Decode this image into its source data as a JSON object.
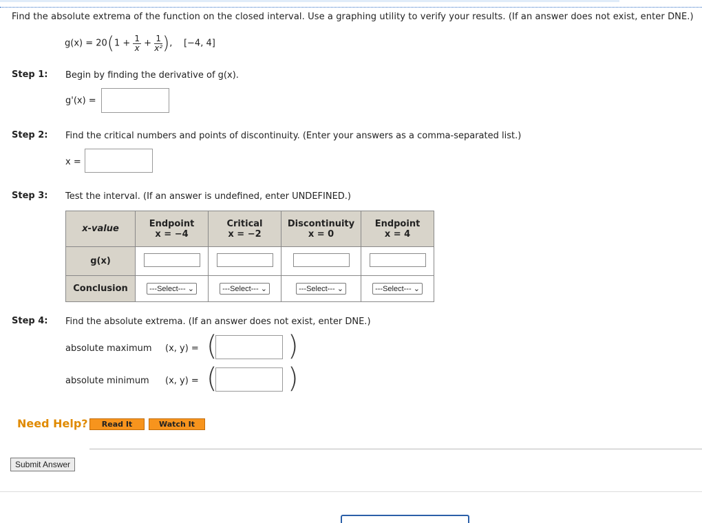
{
  "question": "Find the absolute extrema of the function on the closed interval. Use a graphing utility to verify your results. (If an answer does not exist, enter DNE.)",
  "function": {
    "lhs": "g(x) = 20",
    "one_plus": "1 +",
    "frac1_num": "1",
    "frac1_den": "x",
    "plus": "+",
    "frac2_num": "1",
    "frac2_den": "x²",
    "interval": "[−4, 4]"
  },
  "steps": [
    {
      "label": "Step 1:",
      "text": "Begin by finding the derivative of g(x).",
      "field_label": "g'(x) ="
    },
    {
      "label": "Step 2:",
      "text": "Find the critical numbers and points of discontinuity. (Enter your answers as a comma-separated list.)",
      "field_label": "x ="
    },
    {
      "label": "Step 3:",
      "text": "Test the interval. (If an answer is undefined, enter UNDEFINED.)"
    },
    {
      "label": "Step 4:",
      "text": "Find the absolute extrema. (If an answer does not exist, enter DNE.)"
    }
  ],
  "table": {
    "row_header": "x-value",
    "columns": [
      {
        "title": "Endpoint",
        "sub": "x = −4"
      },
      {
        "title": "Critical",
        "sub": "x = −2"
      },
      {
        "title": "Discontinuity",
        "sub": "x = 0"
      },
      {
        "title": "Endpoint",
        "sub": "x = 4"
      }
    ],
    "gx_label": "g(x)",
    "conclusion_label": "Conclusion",
    "select_placeholder": "---Select---"
  },
  "extrema": {
    "max_label": "absolute maximum",
    "min_label": "absolute minimum",
    "xy_label": "(x, y) ="
  },
  "help": {
    "label": "Need Help?",
    "read": "Read It",
    "watch": "Watch It"
  },
  "submit_label": "Submit Answer"
}
